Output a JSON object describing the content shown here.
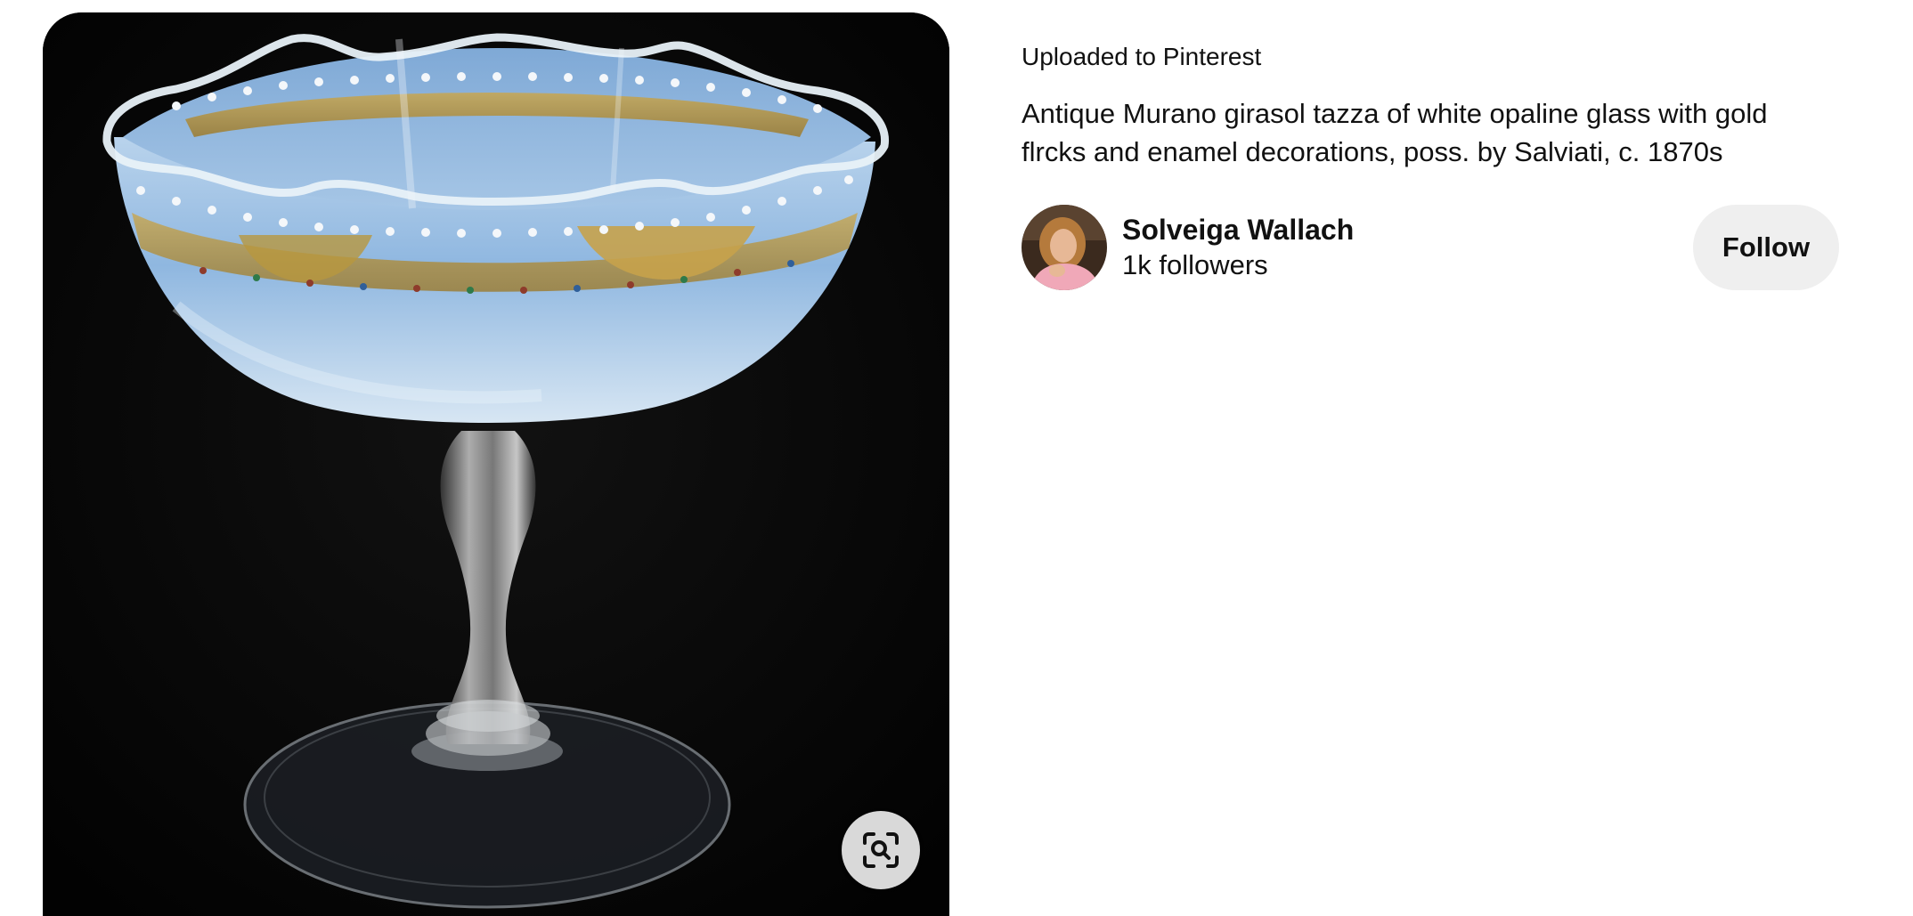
{
  "pin": {
    "upload_source": "Uploaded to Pinterest",
    "description": "Antique Murano girasol tazza of white opaline glass with gold flrcks and enamel decorations, poss. by Salviati, c. 1870s"
  },
  "creator": {
    "name": "Solveiga Wallach",
    "followers": "1k followers",
    "follow_label": "Follow"
  },
  "icons": {
    "visual_search": "visual-search-icon"
  },
  "colors": {
    "follow_button_bg": "#efefef",
    "text": "#111111",
    "visual_search_bg": "#d9d9d9"
  }
}
